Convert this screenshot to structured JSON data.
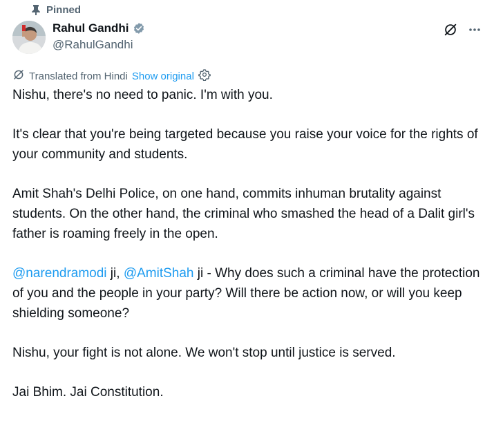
{
  "pinned": {
    "label": "Pinned",
    "icon": "pin-icon"
  },
  "author": {
    "display_name": "Rahul Gandhi",
    "handle": "@RahulGandhi",
    "verified_icon": "verified-badge-icon",
    "avatar_icon": "avatar"
  },
  "actions": {
    "grok_icon": "grok-icon",
    "more_icon": "more-icon"
  },
  "translation": {
    "label": "Translated from Hindi",
    "show_original": "Show original",
    "translate_icon": "translate-icon",
    "settings_icon": "gear-icon"
  },
  "post": {
    "p1": "Nishu, there's no need to panic. I'm with you.",
    "p2": "It's clear that you're being targeted because you raise your voice for the rights of your community and students.",
    "p3": "Amit Shah's Delhi Police, on one hand, commits inhuman brutality against students. On the other hand, the criminal who smashed the head of a Dalit girl's father is roaming freely in the open.",
    "p4": {
      "mention1": "@narendramodi",
      "text1": " ji, ",
      "mention2": "@AmitShah",
      "text2": " ji - Why does such a criminal have the protection of you and the people in your party? Will there be action now, or will you keep shielding someone?"
    },
    "p5": "Nishu, your fight is not alone. We won't stop until justice is served.",
    "p6": "Jai Bhim. Jai Constitution."
  },
  "colors": {
    "text": "#0f1419",
    "secondary": "#536471",
    "link": "#1d9bf0",
    "verified_fill": "#829aab"
  }
}
